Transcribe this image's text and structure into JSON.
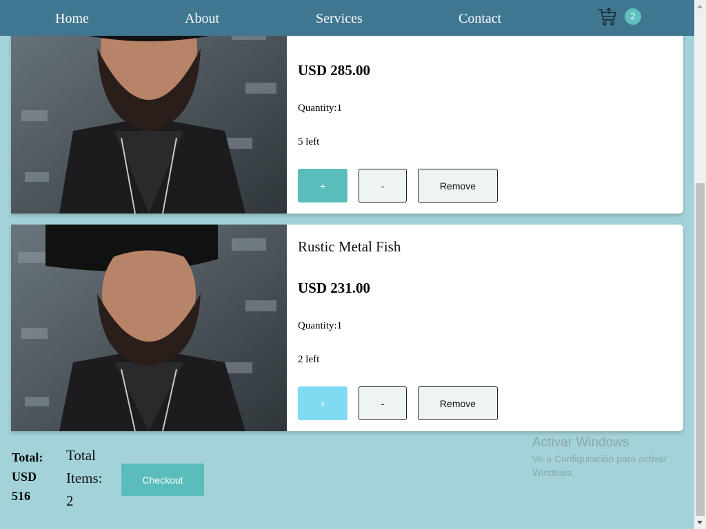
{
  "nav": {
    "links": [
      "Home",
      "About",
      "Services",
      "Contact"
    ],
    "cart_count": "2",
    "bg_color": "#3f7690",
    "cart_icon": "shopping-cart-icon"
  },
  "products": [
    {
      "name": "",
      "price": "USD 285.00",
      "quantity": "Quantity:1",
      "stock": "5 left",
      "plus_label": "+",
      "minus_label": "-",
      "remove_label": "Remove",
      "plus_color": "#5bbcbc"
    },
    {
      "name": "Rustic Metal Fish",
      "price": "USD 231.00",
      "quantity": "Quantity:1",
      "stock": "2 left",
      "plus_label": "+",
      "minus_label": "-",
      "remove_label": "Remove",
      "plus_color": "#7fdbf2"
    }
  ],
  "summary": {
    "total_label": "Total:",
    "total_currency": "USD",
    "total_value": "516",
    "items_word1": "Total",
    "items_word2": "Items:",
    "items_count": "2",
    "checkout_label": "Checkout",
    "checkout_color": "#5bbcbc"
  },
  "watermark": {
    "title": "Activar Windows",
    "subtitle": "Ve a Configuración para activar Windows."
  }
}
